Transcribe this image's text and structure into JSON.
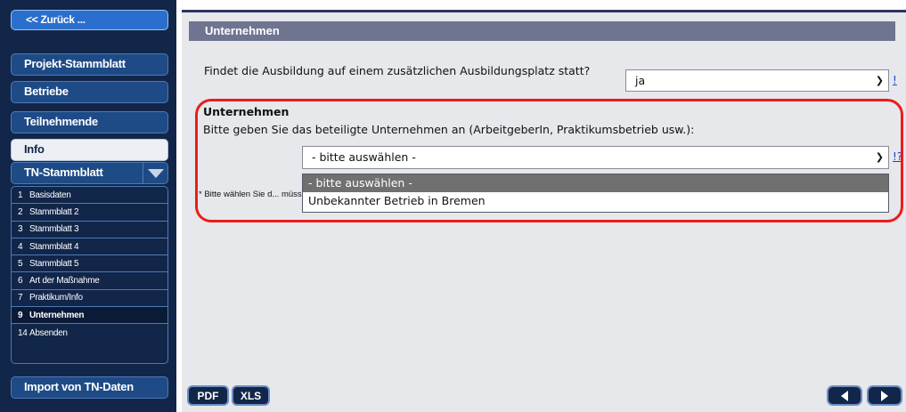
{
  "sidebar": {
    "back_label": "<< Zurück ...",
    "items": [
      {
        "label": "Projekt-Stammblatt"
      },
      {
        "label": "Betriebe"
      },
      {
        "label": "Teilnehmende"
      },
      {
        "label": "Info"
      },
      {
        "label": "TN-Stammblatt"
      }
    ],
    "submenu": [
      {
        "num": "1",
        "label": "Basisdaten"
      },
      {
        "num": "2",
        "label": "Stammblatt 2"
      },
      {
        "num": "3",
        "label": "Stammblatt 3"
      },
      {
        "num": "4",
        "label": "Stammblatt 4"
      },
      {
        "num": "5",
        "label": "Stammblatt 5"
      },
      {
        "num": "6",
        "label": "Art der Maßnahme"
      },
      {
        "num": "7",
        "label": "Praktikum/Info"
      },
      {
        "num": "9",
        "label": "Unternehmen"
      },
      {
        "num": "14",
        "label": "Absenden"
      }
    ],
    "import_label": "Import von TN-Daten"
  },
  "main": {
    "header": "Unternehmen",
    "question1": {
      "label": "Findet die Ausbildung auf einem zusätzlichen Ausbildungsplatz statt?",
      "value": "ja",
      "help": "!"
    },
    "section_title": "Unternehmen",
    "section_prompt": "Bitte geben Sie das beteiligte Unternehmen an (ArbeitgeberIn, Praktikumsbetrieb usw.):",
    "company_select": {
      "value": "- bitte auswählen -",
      "help": "!?",
      "options": [
        "- bitte auswählen -",
        "Unbekannter Betrieb in Bremen"
      ]
    },
    "hint": "* Bitte wählen Sie d... müssen Sie zunächst ein Stammblatt unter \"Betriebe\" anlegen."
  },
  "footer": {
    "pdf_label": "PDF",
    "xls_label": "XLS"
  }
}
